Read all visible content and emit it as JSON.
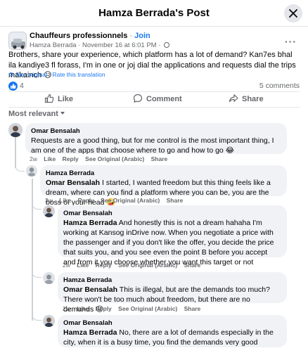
{
  "header": {
    "title": "Hamza Berrada's Post"
  },
  "post": {
    "group_name": "Chauffeurs professionnels",
    "separator": "·",
    "join_label": "Join",
    "author": "Hamza Berrada",
    "date": "November 16 at 6:01 PM",
    "text": "Brothers, share your experience, which platform has a lot of demand? Kan7es bhal ila kandiye3 fl forass, I'm in one or joj dial the applications and requests dial the trips makainch 😥",
    "see_original": "See original",
    "rate_translation": "Rate this translation",
    "translate_separator": "·",
    "like_count": "4",
    "comment_count": "5 comments"
  },
  "actions": {
    "like": "Like",
    "comment": "Comment",
    "share": "Share"
  },
  "sort": {
    "label": "Most relevant"
  },
  "comments": [
    {
      "author": "Omar Bensalah",
      "mention": "",
      "text": "Requests are a good thing, but for me control is the most important thing, I am one of the apps that choose where to go and how to go 😂",
      "time": "2w",
      "like": "Like",
      "reply": "Reply",
      "see_original": "See Original (Arabic)",
      "share": "Share"
    },
    {
      "author": "Hamza Berrada",
      "mention": "Omar Bensalah",
      "text": "I started, I wanted freedom but this thing feels like a dream, where can you find a platform where you can be, you are the boss of your head 🤪",
      "time": "2w",
      "like": "Like",
      "reply": "Reply",
      "see_original": "See Original (Arabic)",
      "share": "Share"
    },
    {
      "author": "Omar Bensalah",
      "mention": "Hamza Berrada",
      "text": "And honestly this is not a dream hahaha I'm working at Kansog inDrive now. When you negotiate a price with the passenger and if you don't like the offer, you decide the price that suits you, and you see even the point B before you accept and from it you choose whether you want this target or not",
      "time": "2w",
      "like": "Like",
      "reply": "Reply",
      "see_original": "See Original (Arabic)",
      "share": "Share"
    },
    {
      "author": "Hamza Berrada",
      "mention": "Omar Bensalah",
      "text": "This is illegal, but are the demands too much? There won't be too much about freedom, but there are no demands 😜",
      "time": "2w",
      "like": "Like",
      "reply": "Reply",
      "see_original": "See Original (Arabic)",
      "share": "Share"
    },
    {
      "author": "Omar Bensalah",
      "mention": "Hamza Berrada",
      "text": "No, there are a lot of demands especially in the city, when it is a busy time, you find the demands very good",
      "time": "",
      "like": "",
      "reply": "",
      "see_original": "",
      "share": ""
    }
  ],
  "colors": {
    "accent": "#1877f2",
    "bubble": "#f0f2f5",
    "muted": "#65676b",
    "divider": "#e4e6eb"
  },
  "icons": [
    "close-icon",
    "more-icon",
    "globe-icon",
    "gear-icon",
    "like-icon",
    "comment-icon",
    "share-icon",
    "chevron-down-icon"
  ]
}
